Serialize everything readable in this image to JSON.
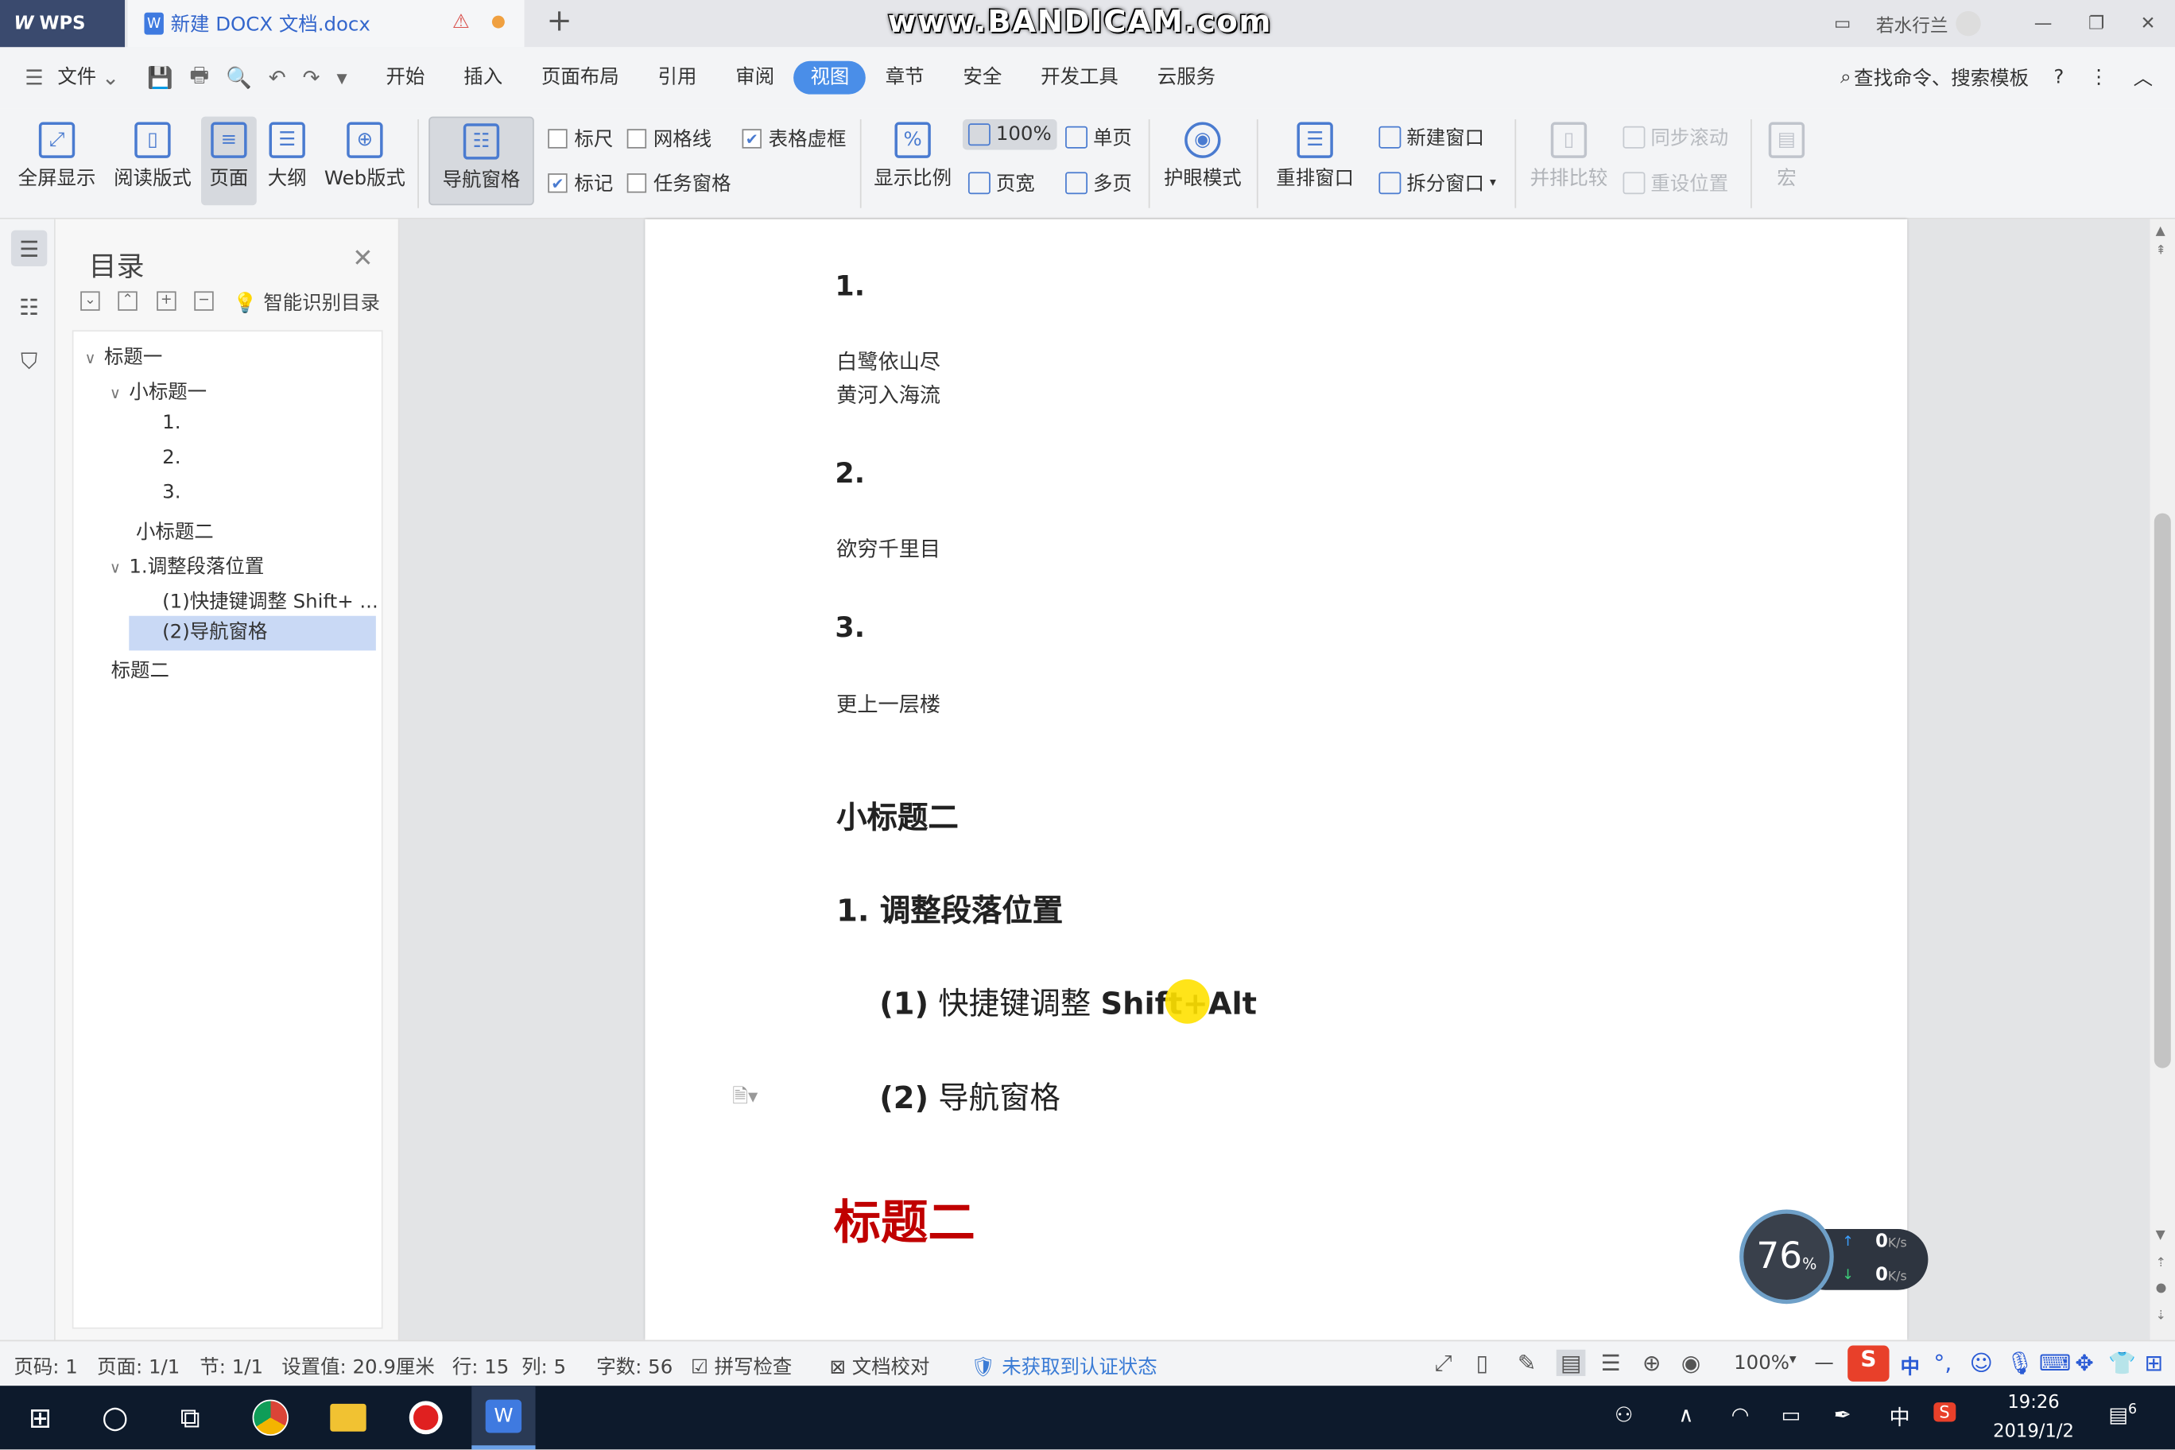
{
  "titlebar": {
    "app_name": "WPS",
    "doc_tab": "新建 DOCX 文档.docx",
    "watermark": "www.BANDICAM.com",
    "user": "若水行兰"
  },
  "menu": {
    "file": "文件",
    "items": [
      "开始",
      "插入",
      "页面布局",
      "引用",
      "审阅",
      "视图",
      "章节",
      "安全",
      "开发工具",
      "云服务"
    ],
    "active": "视图",
    "search": "查找命令、搜索模板",
    "help": "?"
  },
  "ribbon": {
    "fullscreen": "全屏显示",
    "reading": "阅读版式",
    "page": "页面",
    "outline": "大纲",
    "web": "Web版式",
    "nav_pane": "导航窗格",
    "ruler": "标尺",
    "gridlines": "网格线",
    "table_border": "表格虚框",
    "marks": "标记",
    "task_pane": "任务窗格",
    "zoom": "显示比例",
    "zoom_100": "100%",
    "page_width": "页宽",
    "single_page": "单页",
    "multi_page": "多页",
    "eye_mode": "护眼模式",
    "arrange": "重排窗口",
    "new_window": "新建窗口",
    "split_window": "拆分窗口",
    "side_by_side": "并排比较",
    "sync_scroll": "同步滚动",
    "reset_pos": "重设位置",
    "macro": "宏"
  },
  "navpane": {
    "title": "目录",
    "smart": "智能识别目录",
    "tree": [
      {
        "label": "标题一",
        "level": 0
      },
      {
        "label": "小标题一",
        "level": 1
      },
      {
        "label": "1.",
        "level": 2
      },
      {
        "label": "2.",
        "level": 2
      },
      {
        "label": "3.",
        "level": 2
      },
      {
        "label": "小标题二",
        "level": 1
      },
      {
        "label": "1.调整段落位置",
        "level": 1
      },
      {
        "label": "(1)快捷键调整 Shift+ ...",
        "level": 2
      },
      {
        "label": "(2)导航窗格",
        "level": 2,
        "selected": true
      },
      {
        "label": "标题二",
        "level": 0
      }
    ]
  },
  "document": {
    "h1": "1.",
    "p1a": "白鹭依山尽",
    "p1b": "黄河入海流",
    "h2": "2.",
    "p2": "欲穷千里目",
    "h3": "3.",
    "p3": "更上一层楼",
    "sub2": "小标题二",
    "sec1_num": "1.",
    "sec1_text": "调整段落位置",
    "item1_num": "(1)",
    "item1_text": "快捷键调整",
    "item1_keys": "Shift+Alt",
    "item2_num": "(2)",
    "item2_text": "导航窗格",
    "title2": "标题二"
  },
  "netwidget": {
    "percent": "76",
    "unit": "%",
    "up": "0",
    "down": "0",
    "rate_unit": "K/s"
  },
  "status": {
    "page_no": "页码: 1",
    "pages": "页面: 1/1",
    "section": "节: 1/1",
    "setting": "设置值: 20.9厘米",
    "row": "行: 15",
    "col": "列: 5",
    "words": "字数: 56",
    "spell": "拼写检查",
    "proof": "文档校对",
    "cert": "未获取到认证状态",
    "zoom": "100%"
  },
  "ime": {
    "lang": "中"
  },
  "taskbar": {
    "time": "19:26",
    "date": "2019/1/2",
    "lang": "中",
    "notif": "6"
  },
  "colors": {
    "accent": "#4a8ee8",
    "heading_red": "#c00000",
    "selected": "#c9d9f5"
  }
}
